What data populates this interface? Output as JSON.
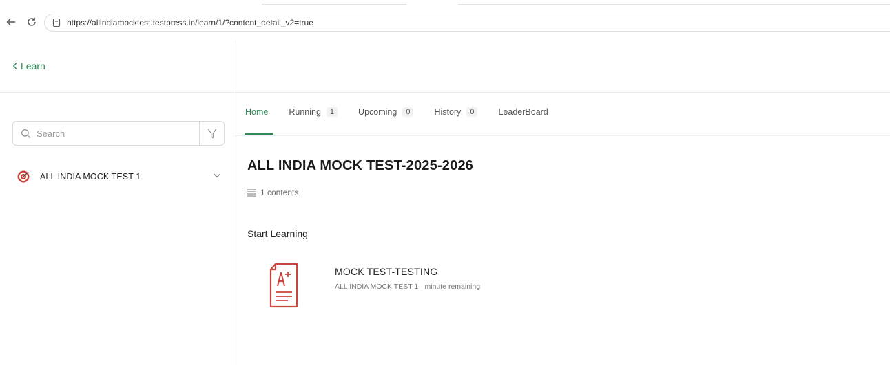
{
  "browser": {
    "url": "https://allindiamocktest.testpress.in/learn/1/?content_detail_v2=true"
  },
  "sidebar": {
    "back_label": "Learn",
    "search_placeholder": "Search",
    "course": {
      "label": "ALL INDIA MOCK TEST 1",
      "icon": "target-icon"
    }
  },
  "tabs": [
    {
      "label": "Home",
      "active": true
    },
    {
      "label": "Running",
      "count": "1"
    },
    {
      "label": "Upcoming",
      "count": "0"
    },
    {
      "label": "History",
      "count": "0"
    },
    {
      "label": "LeaderBoard"
    }
  ],
  "main": {
    "title": "ALL INDIA MOCK TEST-2025-2026",
    "contents_count": "1 contents",
    "section_heading": "Start Learning",
    "item": {
      "title": "MOCK TEST-TESTING",
      "subtitle": "ALL INDIA MOCK TEST 1 · minute remaining",
      "icon": "exam-sheet-icon"
    }
  },
  "colors": {
    "accent": "#2e8b57",
    "icon_red": "#c9463d"
  }
}
